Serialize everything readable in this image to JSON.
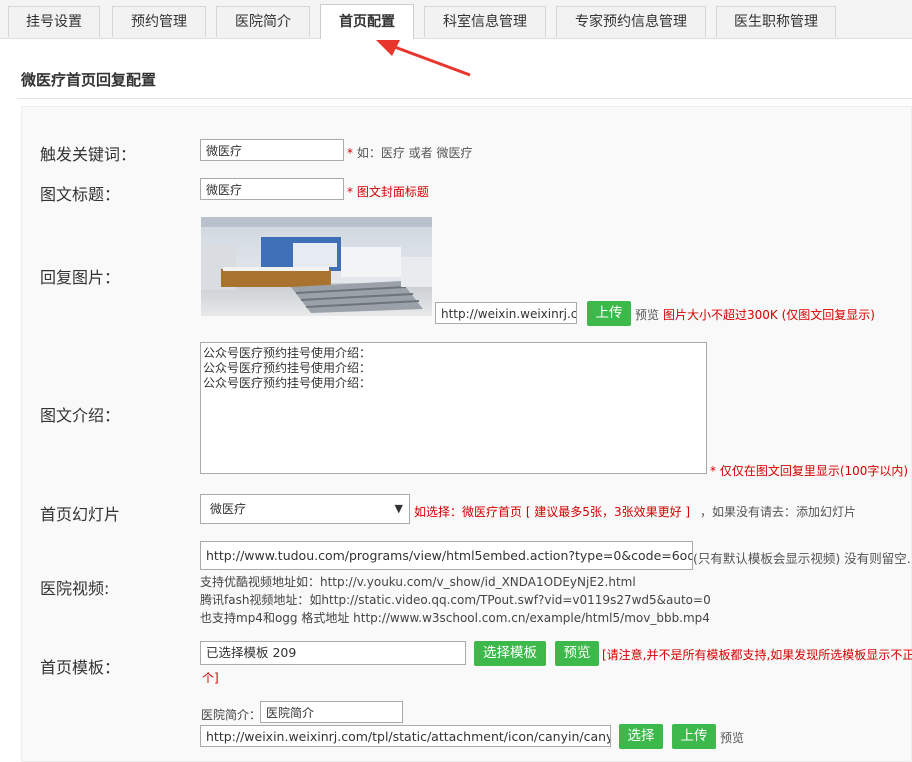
{
  "tabs": [
    "挂号设置",
    "预约管理",
    "医院简介",
    "首页配置",
    "科室信息管理",
    "专家预约信息管理",
    "医生职称管理"
  ],
  "section_title": "微医疗首页回复配置",
  "form": {
    "keyword": {
      "label": "触发关键词：",
      "value": "微医疗",
      "hint_star": "*",
      "hint": " 如：医疗 或者 微医疗"
    },
    "title": {
      "label": "图文标题：",
      "value": "微医疗",
      "hint": "* 图文封面标题"
    },
    "image": {
      "label": "回复图片：",
      "url": "http://weixin.weixinrj.com",
      "upload": "上传",
      "preview": "预览",
      "hint": "图片大小不超过300K (仅图文回复显示)"
    },
    "intro": {
      "label": "图文介绍：",
      "lines": [
        "公众号医疗预约挂号使用介绍：",
        "公众号医疗预约挂号使用介绍：",
        "公众号医疗预约挂号使用介绍："
      ],
      "hint": "* 仅仅在图文回复里显示(100字以内)"
    },
    "slideshow": {
      "label": "首页幻灯片",
      "selected": "微医疗",
      "hint_red": "如选择：微医疗首页 [ 建议最多5张，3张效果更好 ]",
      "hint_plain": "，如果没有请去：添加幻灯片"
    },
    "video": {
      "label": "医院视频:",
      "url": "http://www.tudou.com/programs/view/html5embed.action?type=0&code=6oqY2eS",
      "hint": "(只有默认模板会显示视频) 没有则留空.",
      "notes": [
        "支持优酷视频地址如：http://v.youku.com/v_show/id_XNDA1ODEyNjE2.html",
        "腾讯fash视频地址：如http://static.video.qq.com/TPout.swf?vid=v0119s27wd5&auto=0",
        "也支持mp4和ogg 格式地址 http://www.w3school.com.cn/example/html5/mov_bbb.mp4"
      ]
    },
    "template": {
      "label": "首页模板：",
      "value": "已选择模板 209",
      "choose": "选择模板",
      "preview": "预览",
      "hint_line1": "[请注意,并不是所有模板都支持,如果发现所选模板显示不正",
      "hint_line2": "个]"
    },
    "intro_entry": {
      "label": "医院简介：",
      "value": "医院简介",
      "url": "http://weixin.weixinrj.com/tpl/static/attachment/icon/canyin/canyin_red",
      "choose": "选择",
      "upload": "上传",
      "preview": "预览"
    }
  },
  "colors": {
    "accent_green": "#3cb94a",
    "hint_red": "#d40000",
    "arrow_red": "#e8362d"
  }
}
